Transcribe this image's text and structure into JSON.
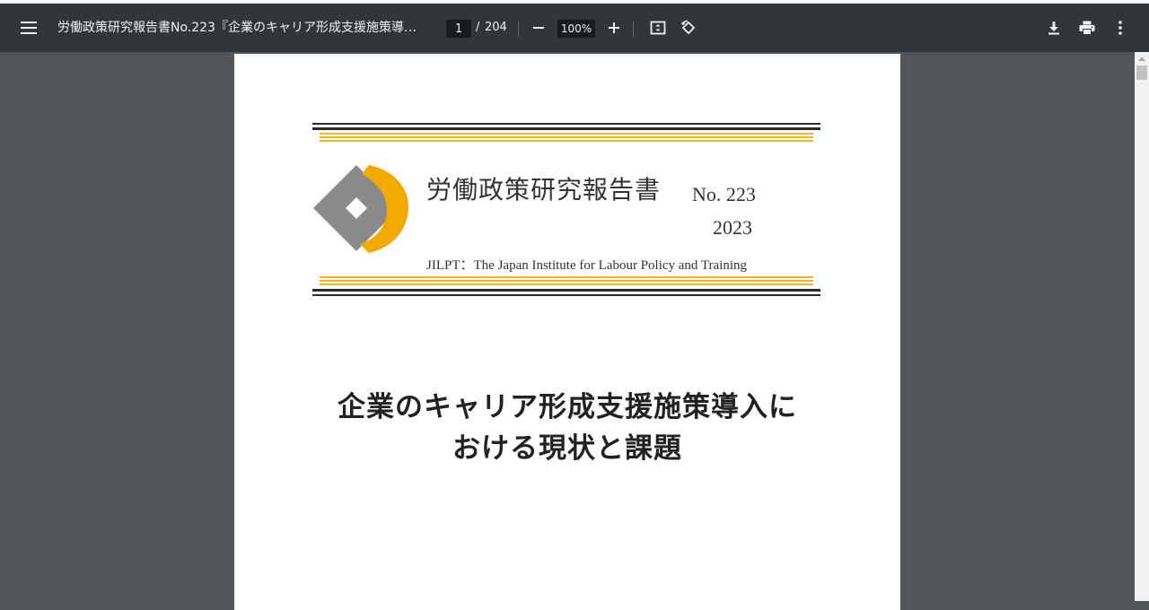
{
  "toolbar": {
    "title": "労働政策研究報告書No.223『企業のキャリア形成支援施策導入にお...",
    "page_current": "1",
    "page_separator": "/",
    "page_total": "204",
    "zoom": "100%",
    "icons": {
      "menu": "menu-icon",
      "zoom_out": "minus-icon",
      "zoom_in": "plus-icon",
      "fit": "fit-to-page-icon",
      "rotate": "rotate-icon",
      "download": "download-icon",
      "print": "print-icon",
      "more": "more-vert-icon"
    }
  },
  "document": {
    "series_name": "労働政策研究報告書",
    "report_number": "No. 223",
    "year": "2023",
    "institute": "JILPT：The Japan Institute for Labour Policy and Training",
    "title_line1": "企業のキャリア形成支援施策導入に",
    "title_line2": "おける現状と課題"
  },
  "colors": {
    "toolbar_bg": "#323639",
    "viewer_bg": "#525659",
    "band_dark": "#2b2b2b",
    "band_gold": "#f2b51f",
    "logo_gray": "#8a8a8a",
    "logo_gold": "#f2a900"
  }
}
